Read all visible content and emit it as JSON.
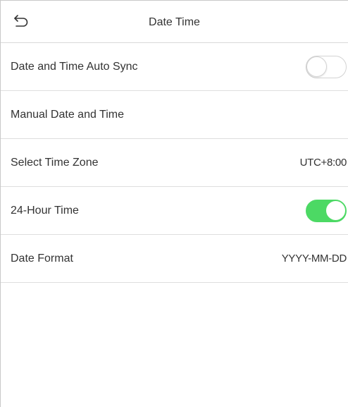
{
  "header": {
    "title": "Date Time",
    "back_icon": "back-arrow-icon"
  },
  "settings": [
    {
      "label": "Date and Time Auto Sync",
      "type": "toggle",
      "state": "off"
    },
    {
      "label": "Manual Date and Time",
      "type": "link"
    },
    {
      "label": "Select Time Zone",
      "type": "value",
      "value": "UTC+8:00"
    },
    {
      "label": "24-Hour Time",
      "type": "toggle",
      "state": "on"
    },
    {
      "label": "Date Format",
      "type": "value",
      "value": "YYYY-MM-DD"
    }
  ],
  "colors": {
    "toggle_on": "#4cd964",
    "toggle_off_border": "#d3d3d3",
    "divider": "#dedede",
    "text": "#333333"
  }
}
